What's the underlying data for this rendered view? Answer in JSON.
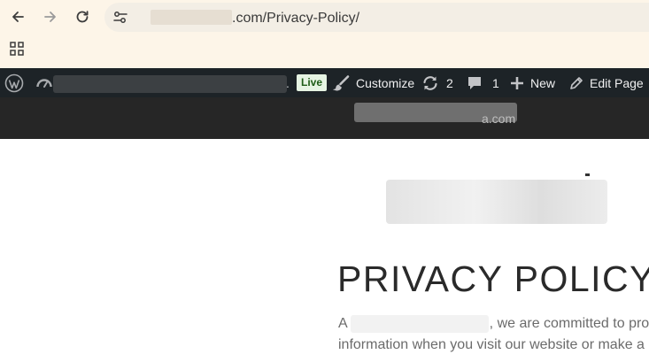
{
  "browser": {
    "url_visible": ".com/Privacy-Policy/",
    "icons": {
      "back": "arrow-left-icon",
      "forward": "arrow-right-icon",
      "reload": "reload-icon",
      "site_info": "tune-icon",
      "apps": "apps-grid-icon"
    }
  },
  "admin_bar": {
    "live_label": "Live",
    "customize_label": "Customize",
    "updates_count": "2",
    "comments_count": "1",
    "new_label": "New",
    "edit_page_label": "Edit Page",
    "dot": "."
  },
  "site_header": {
    "text_fragment": "a.com"
  },
  "content": {
    "title": "PRIVACY POLICY",
    "line1_start": "A",
    "line1_end": ", we are committed to pro",
    "line2": "information when you visit our website or make a p"
  },
  "colors": {
    "browser_bg": "#fdf5e8",
    "admin_bar_bg": "#1d2327",
    "header_bg": "#262626",
    "live_badge_bg": "#e6f4e3"
  }
}
